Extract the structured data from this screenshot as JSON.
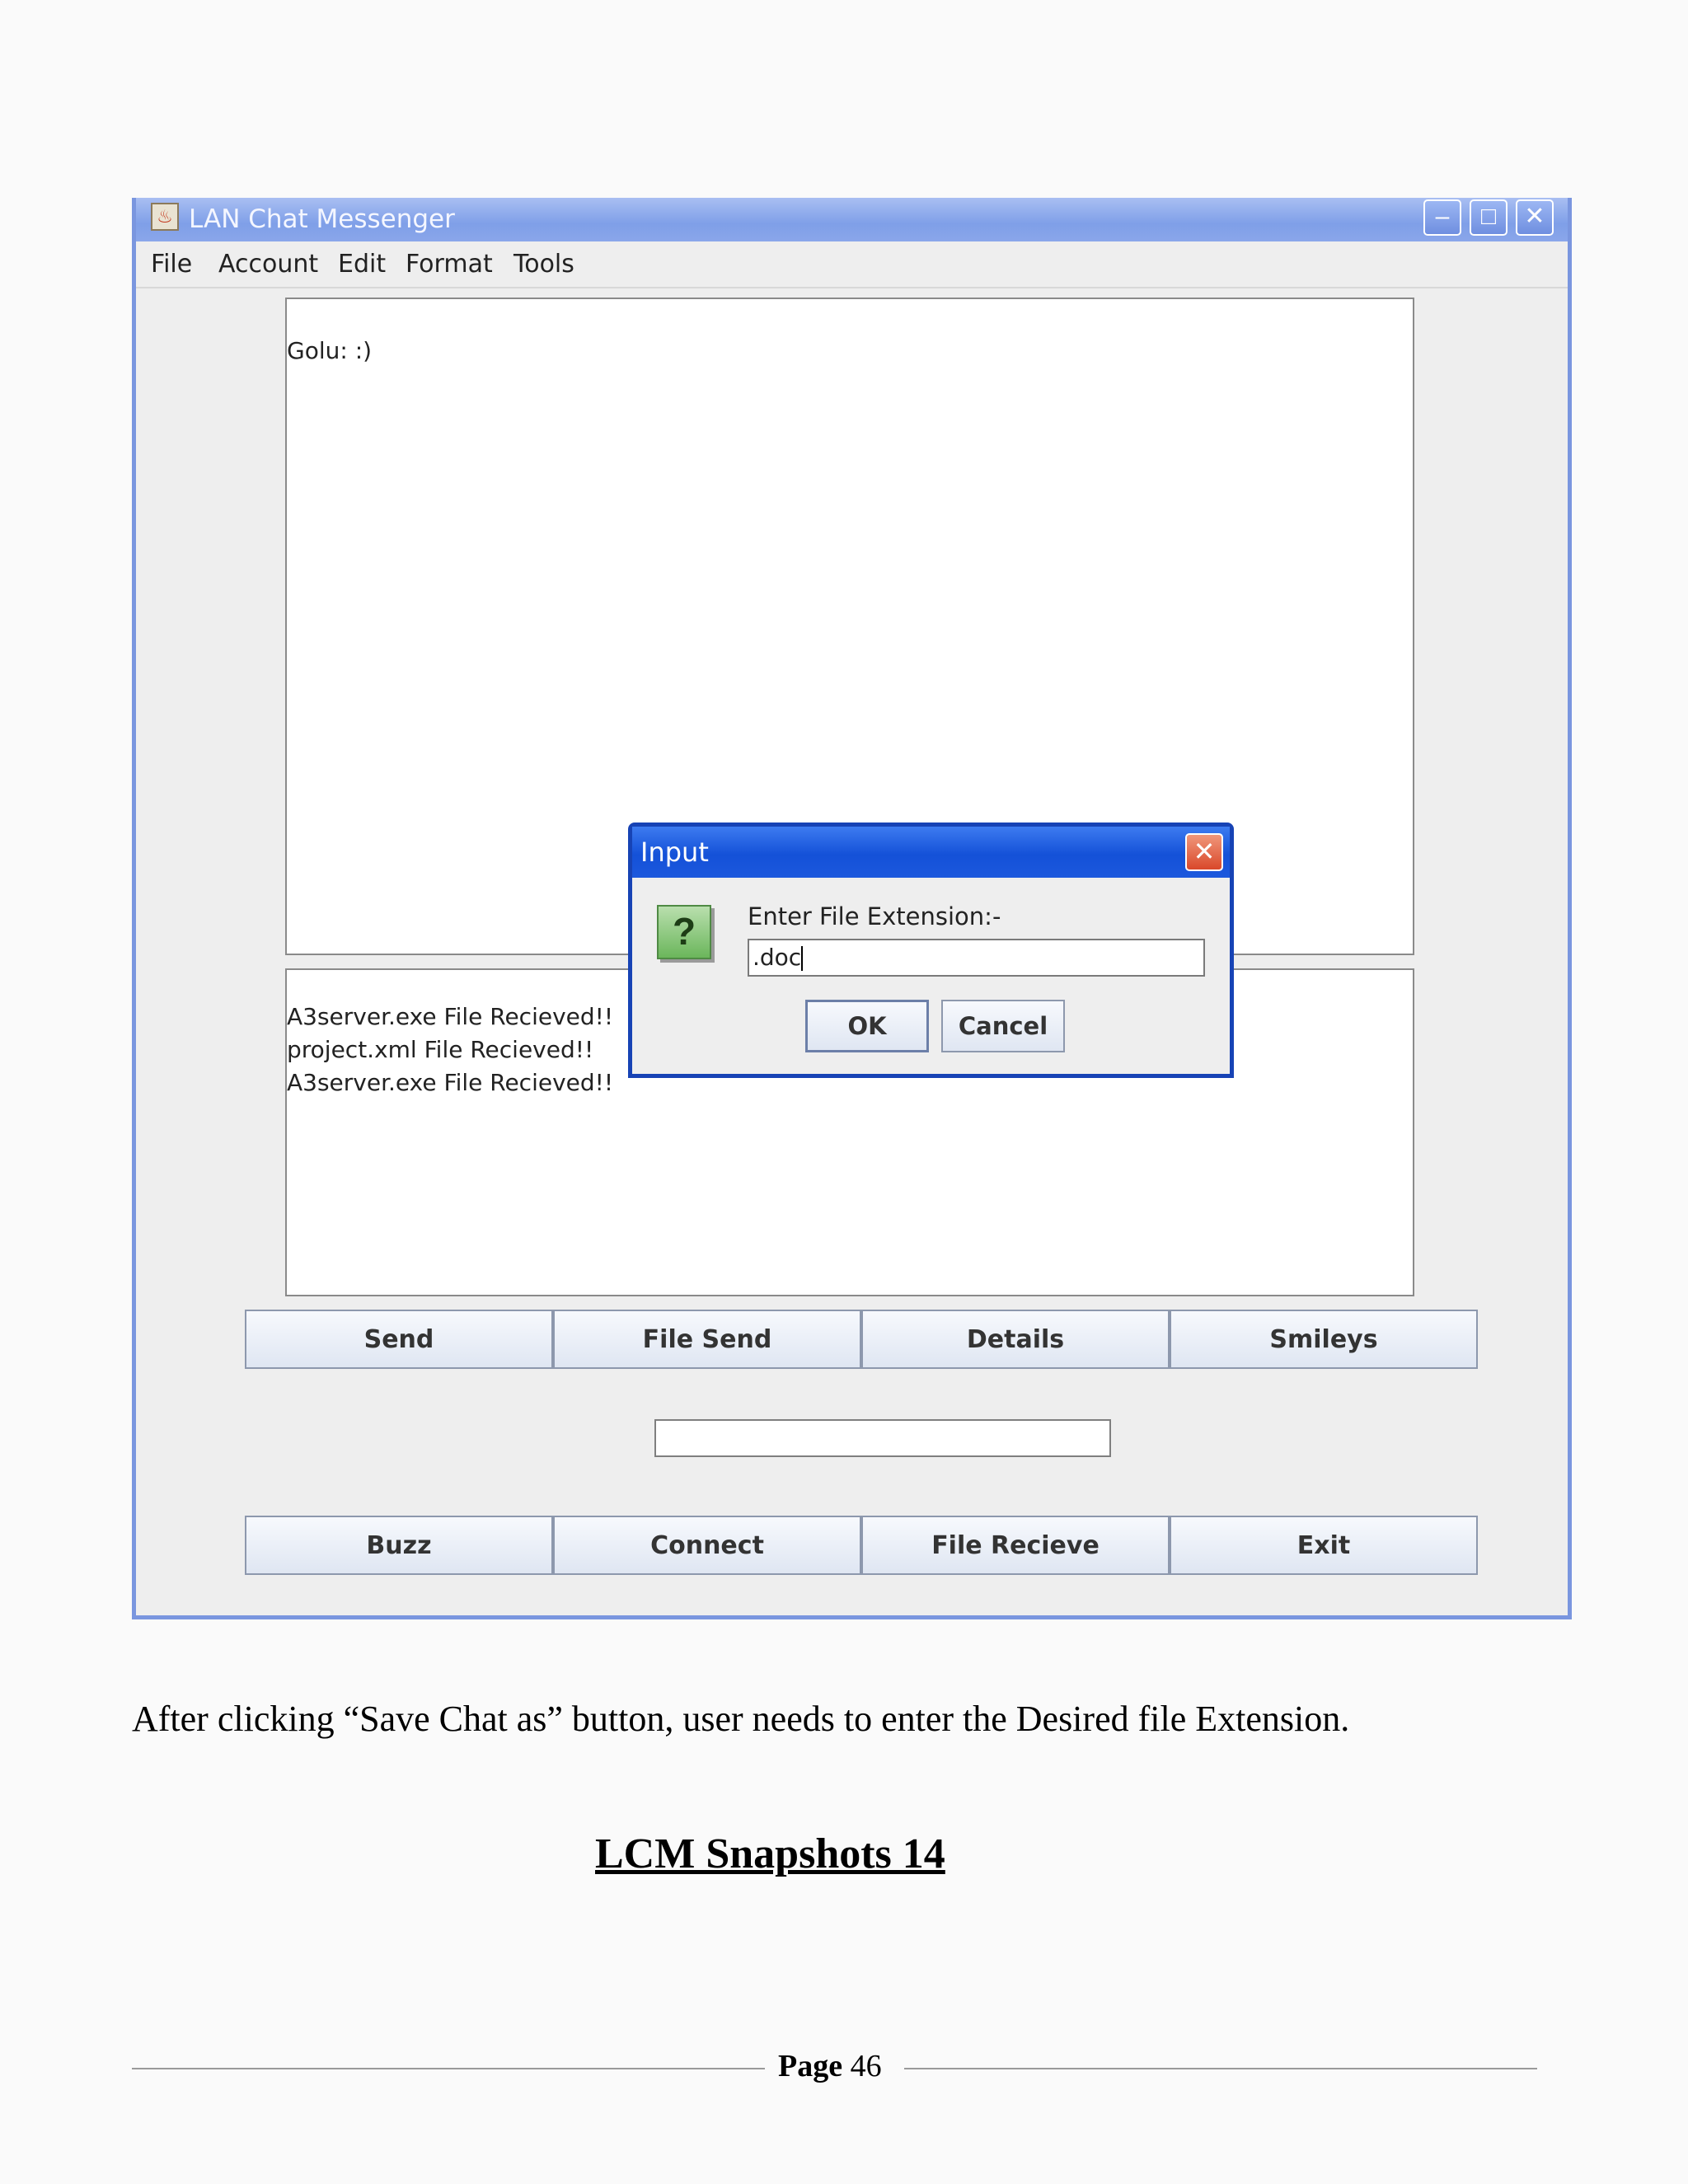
{
  "window": {
    "title": "LAN Chat Messenger",
    "minimize_glyph": "–",
    "maximize_glyph": "□",
    "close_glyph": "✕",
    "app_icon_glyph": "♨"
  },
  "menu": [
    "File",
    "Account",
    "Edit",
    "Format",
    "Tools"
  ],
  "chat": {
    "line": "Golu: :)"
  },
  "log": {
    "lines": [
      "A3server.exe File Recieved!!",
      "project.xml File Recieved!!",
      "A3server.exe File Recieved!!"
    ]
  },
  "buttons_row1": [
    "Send",
    "File Send",
    "Details",
    "Smileys"
  ],
  "buttons_row2": [
    "Buzz",
    "Connect",
    "File Recieve",
    "Exit"
  ],
  "dialog": {
    "title": "Input",
    "close_glyph": "✕",
    "icon_glyph": "?",
    "prompt": "Enter File Extension:-",
    "value": ".doc",
    "ok": "OK",
    "cancel": "Cancel"
  },
  "document": {
    "caption": "After clicking “Save Chat as” button, user needs to enter the Desired file Extension.",
    "heading": "LCM Snapshots 14",
    "footer_label": "Page",
    "footer_number": "46"
  }
}
